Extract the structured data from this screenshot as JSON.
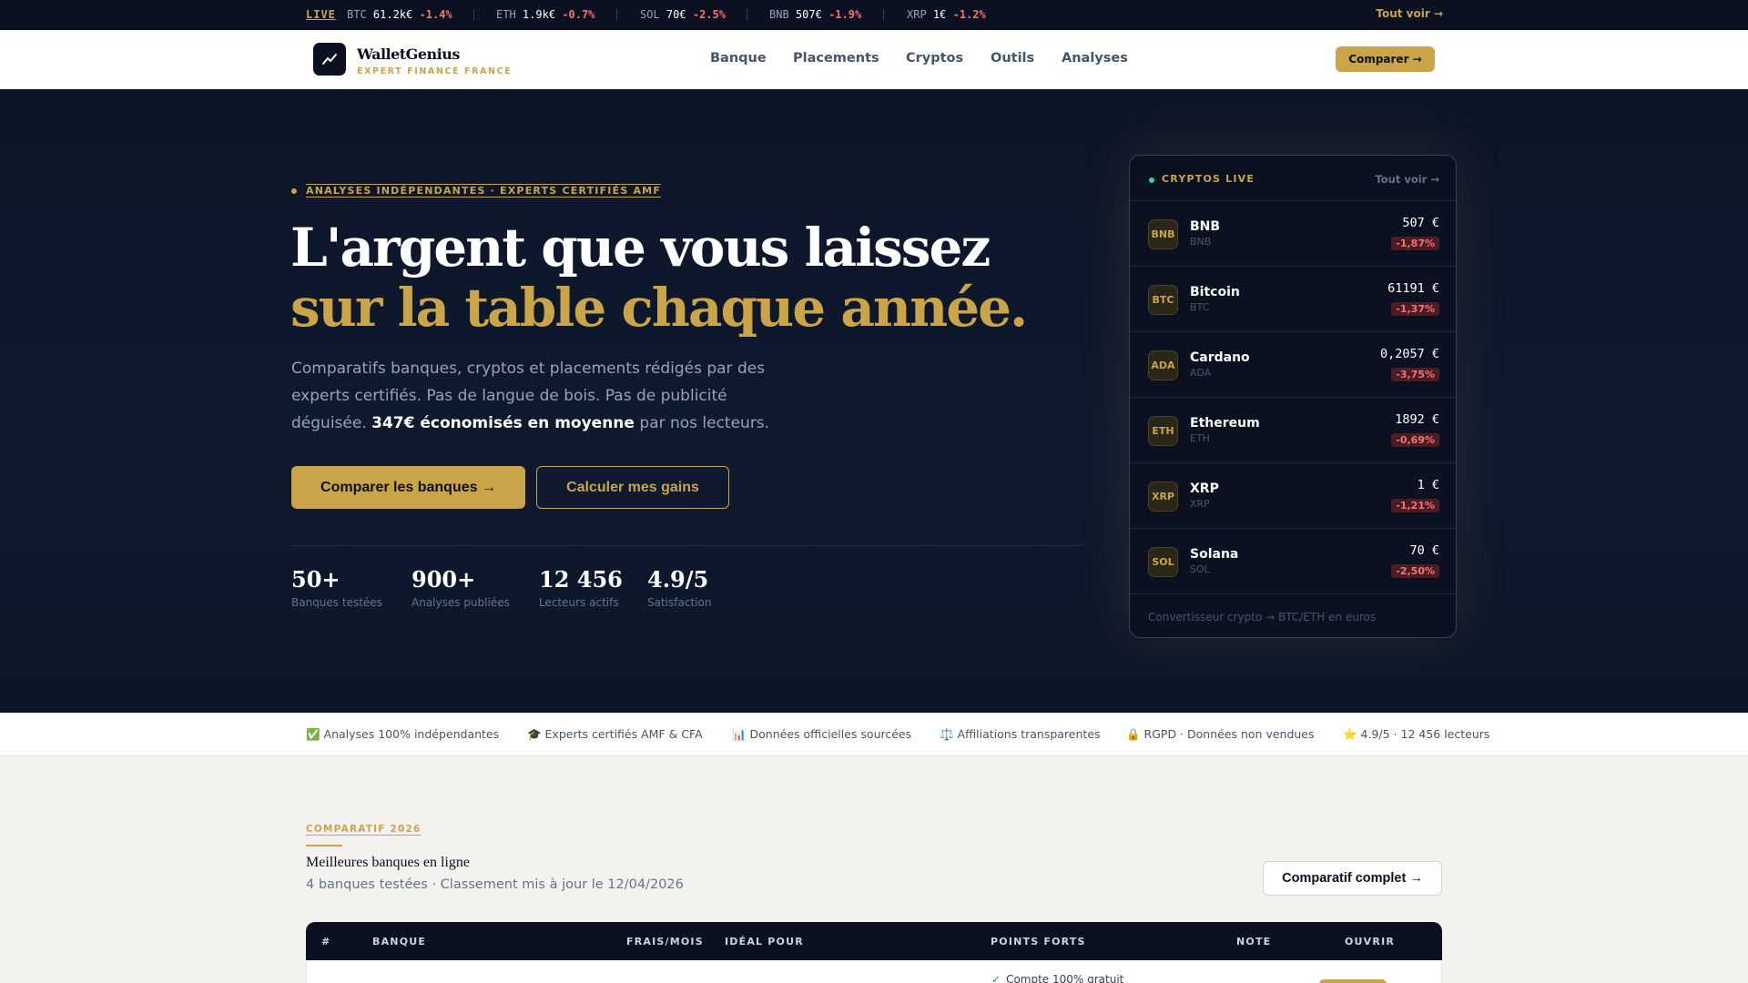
{
  "ticker": {
    "live_label": "LIVE",
    "items": [
      {
        "sym": "BTC",
        "price": "61.2k€",
        "chg": "-1.4%"
      },
      {
        "sym": "ETH",
        "price": "1.9k€",
        "chg": "-0.7%"
      },
      {
        "sym": "SOL",
        "price": "70€",
        "chg": "-2.5%"
      },
      {
        "sym": "BNB",
        "price": "507€",
        "chg": "-1.9%"
      },
      {
        "sym": "XRP",
        "price": "1€",
        "chg": "-1.2%"
      }
    ],
    "see_all": "Tout voir →"
  },
  "nav": {
    "logo_icon": "trending-up-icon",
    "brand": "WalletGenius",
    "tagline": "EXPERT FINANCE FRANCE",
    "links": [
      "Banque",
      "Placements",
      "Cryptos",
      "Outils",
      "Analyses"
    ],
    "cta": "Comparer →"
  },
  "hero": {
    "eyebrow": "ANALYSES INDÉPENDANTES · EXPERTS CERTIFIÉS AMF",
    "title_line1": "L'argent que vous laissez",
    "title_line2": "sur la table chaque année.",
    "lead_part1": "Comparatifs banques, cryptos et placements rédigés par des experts certifiés. Pas de langue de bois. Pas de publicité déguisée. ",
    "lead_strong": "347€ économisés en moyenne",
    "lead_part2": " par nos lecteurs.",
    "primary_button": "Comparer les banques →",
    "secondary_button": "Calculer mes gains",
    "stats": [
      {
        "value": "50+",
        "label": "Banques testées"
      },
      {
        "value": "900+",
        "label": "Analyses publiées"
      },
      {
        "value": "12 456",
        "label": "Lecteurs actifs"
      },
      {
        "value": "4.9/5",
        "label": "Satisfaction"
      }
    ]
  },
  "crypto_card": {
    "title": "CRYPTOS LIVE",
    "see_all": "Tout voir →",
    "rows": [
      {
        "badge": "BNB",
        "name": "BNB",
        "sym": "BNB",
        "price": "507 €",
        "chg": "-1,87%"
      },
      {
        "badge": "BTC",
        "name": "Bitcoin",
        "sym": "BTC",
        "price": "61191 €",
        "chg": "-1,37%"
      },
      {
        "badge": "ADA",
        "name": "Cardano",
        "sym": "ADA",
        "price": "0,2057 €",
        "chg": "-3,75%"
      },
      {
        "badge": "ETH",
        "name": "Ethereum",
        "sym": "ETH",
        "price": "1892 €",
        "chg": "-0,69%"
      },
      {
        "badge": "XRP",
        "name": "XRP",
        "sym": "XRP",
        "price": "1 €",
        "chg": "-1,21%"
      },
      {
        "badge": "SOL",
        "name": "Solana",
        "sym": "SOL",
        "price": "70 €",
        "chg": "-2,50%"
      }
    ],
    "footer": "Convertisseur crypto → BTC/ETH en euros"
  },
  "trust": [
    "✅ Analyses 100% indépendantes",
    "🎓 Experts certifiés AMF & CFA",
    "📊 Données officielles sourcées",
    "⚖️ Affiliations transparentes",
    "🔒 RGPD · Données non vendues",
    "⭐ 4.9/5 · 12 456 lecteurs"
  ],
  "comparatif": {
    "tag": "COMPARATIF 2026",
    "title": "Meilleures banques en ligne",
    "subtitle": "4 banques testées · Classement mis à jour le 12/04/2026",
    "button": "Comparatif complet →",
    "columns": [
      "#",
      "BANQUE",
      "FRAIS/MOIS",
      "IDÉAL POUR",
      "POINTS FORTS",
      "NOTE",
      "OUVRIR"
    ],
    "first_row_point": "Compte 100% gratuit"
  }
}
